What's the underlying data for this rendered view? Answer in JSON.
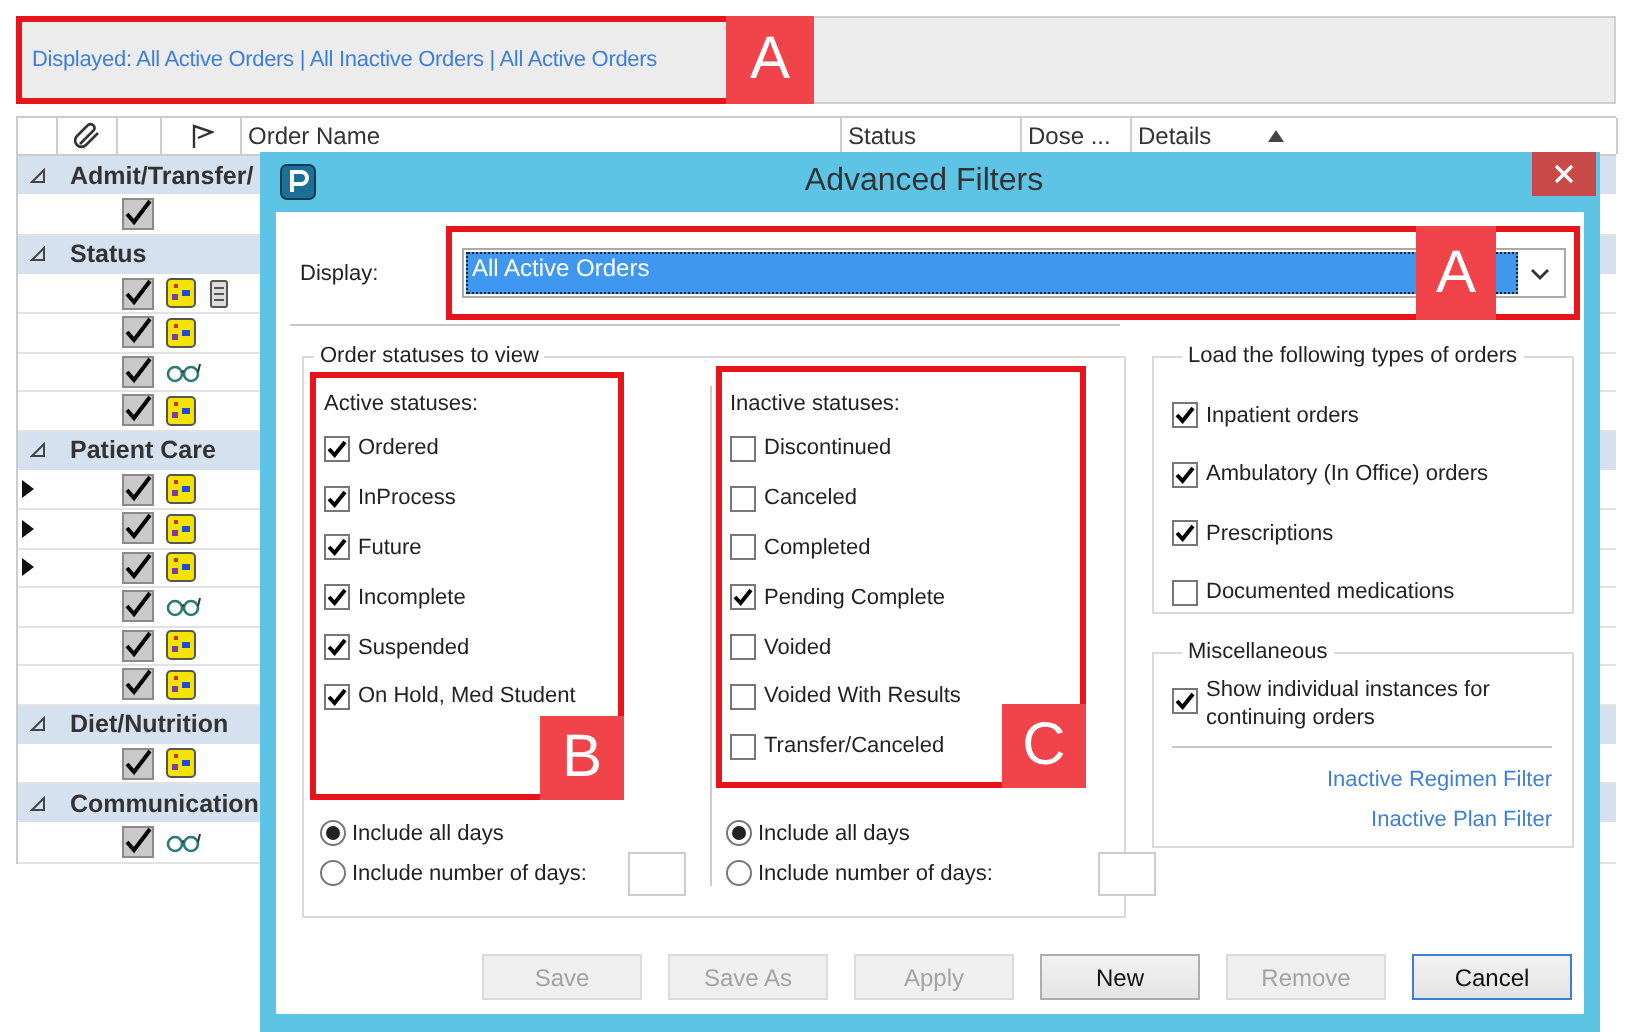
{
  "displayed_bar": {
    "text": "Displayed: All Active Orders | All Inactive Orders | All Active Orders",
    "callout": "A"
  },
  "table": {
    "columns": [
      {
        "kind": "blank"
      },
      {
        "kind": "paperclip"
      },
      {
        "kind": "blank"
      },
      {
        "kind": "flag"
      },
      {
        "kind": "text",
        "label": "Order Name",
        "sorted": false
      },
      {
        "kind": "text",
        "label": "Status",
        "sorted": false
      },
      {
        "kind": "text",
        "label": "Dose ...",
        "sorted": false
      },
      {
        "kind": "text",
        "label": "Details",
        "sorted": true
      }
    ],
    "groups": [
      {
        "name": "Admit/Transfer/",
        "expanded": true,
        "rows": [
          {
            "expandable": false,
            "icons": [
              {
                "kind": "check"
              }
            ]
          }
        ]
      },
      {
        "name": "Status",
        "expanded": true,
        "rows": [
          {
            "expandable": false,
            "icons": [
              {
                "kind": "check"
              },
              {
                "kind": "order"
              },
              {
                "kind": "document"
              }
            ]
          },
          {
            "expandable": false,
            "icons": [
              {
                "kind": "check"
              },
              {
                "kind": "order"
              }
            ]
          },
          {
            "expandable": false,
            "icons": [
              {
                "kind": "check"
              },
              {
                "kind": "glasses"
              }
            ]
          },
          {
            "expandable": false,
            "icons": [
              {
                "kind": "check"
              },
              {
                "kind": "order"
              }
            ]
          }
        ]
      },
      {
        "name": "Patient Care",
        "expanded": true,
        "rows": [
          {
            "expandable": true,
            "icons": [
              {
                "kind": "check"
              },
              {
                "kind": "order"
              }
            ]
          },
          {
            "expandable": true,
            "icons": [
              {
                "kind": "check"
              },
              {
                "kind": "order"
              }
            ]
          },
          {
            "expandable": true,
            "icons": [
              {
                "kind": "check"
              },
              {
                "kind": "order"
              }
            ]
          },
          {
            "expandable": false,
            "icons": [
              {
                "kind": "check"
              },
              {
                "kind": "glasses"
              }
            ]
          },
          {
            "expandable": false,
            "icons": [
              {
                "kind": "check"
              },
              {
                "kind": "order"
              }
            ]
          },
          {
            "expandable": false,
            "icons": [
              {
                "kind": "check"
              },
              {
                "kind": "order"
              }
            ]
          }
        ]
      },
      {
        "name": "Diet/Nutrition",
        "expanded": true,
        "rows": [
          {
            "expandable": false,
            "icons": [
              {
                "kind": "check"
              },
              {
                "kind": "order"
              }
            ]
          }
        ]
      },
      {
        "name": "Communication",
        "expanded": true,
        "rows": [
          {
            "expandable": false,
            "icons": [
              {
                "kind": "check"
              },
              {
                "kind": "glasses"
              }
            ]
          }
        ]
      }
    ]
  },
  "dialog": {
    "title": "Advanced Filters",
    "display": {
      "label": "Display:",
      "value": "All Active Orders",
      "callout": "A"
    },
    "order_statuses": {
      "title": "Order statuses to view",
      "columns": [
        {
          "heading": "Active statuses:",
          "callout": "B",
          "items": [
            {
              "label": "Ordered",
              "checked": true
            },
            {
              "label": "InProcess",
              "checked": true
            },
            {
              "label": "Future",
              "checked": true
            },
            {
              "label": "Incomplete",
              "checked": true
            },
            {
              "label": "Suspended",
              "checked": true
            },
            {
              "label": "On Hold, Med Student",
              "checked": true
            }
          ],
          "days": [
            {
              "label": "Include all days",
              "selected": true
            },
            {
              "label": "Include number of days:",
              "selected": false
            }
          ]
        },
        {
          "heading": "Inactive statuses:",
          "callout": "C",
          "items": [
            {
              "label": "Discontinued",
              "checked": false
            },
            {
              "label": "Canceled",
              "checked": false
            },
            {
              "label": "Completed",
              "checked": false
            },
            {
              "label": "Pending Complete",
              "checked": true
            },
            {
              "label": "Voided",
              "checked": false
            },
            {
              "label": "Voided With Results",
              "checked": false
            },
            {
              "label": "Transfer/Canceled",
              "checked": false
            }
          ],
          "days": [
            {
              "label": "Include all days",
              "selected": true
            },
            {
              "label": "Include number of days:",
              "selected": false
            }
          ]
        }
      ]
    },
    "load_types": {
      "title": "Load the following types of orders",
      "items": [
        {
          "label": "Inpatient orders",
          "checked": true
        },
        {
          "label": "Ambulatory (In Office) orders",
          "checked": true
        },
        {
          "label": "Prescriptions",
          "checked": true
        },
        {
          "label": "Documented medications",
          "checked": false
        }
      ]
    },
    "miscellaneous": {
      "title": "Miscellaneous",
      "items": [
        {
          "label": "Show individual instances for continuing orders",
          "checked": true
        }
      ],
      "links": [
        "Inactive Regimen Filter",
        "Inactive Plan Filter"
      ]
    },
    "buttons": [
      {
        "label": "Save",
        "disabled": true,
        "default": false
      },
      {
        "label": "Save As",
        "disabled": true,
        "default": false
      },
      {
        "label": "Apply",
        "disabled": true,
        "default": false
      },
      {
        "label": "New",
        "disabled": false,
        "default": false
      },
      {
        "label": "Remove",
        "disabled": true,
        "default": false
      },
      {
        "label": "Cancel",
        "disabled": false,
        "default": true
      }
    ]
  }
}
